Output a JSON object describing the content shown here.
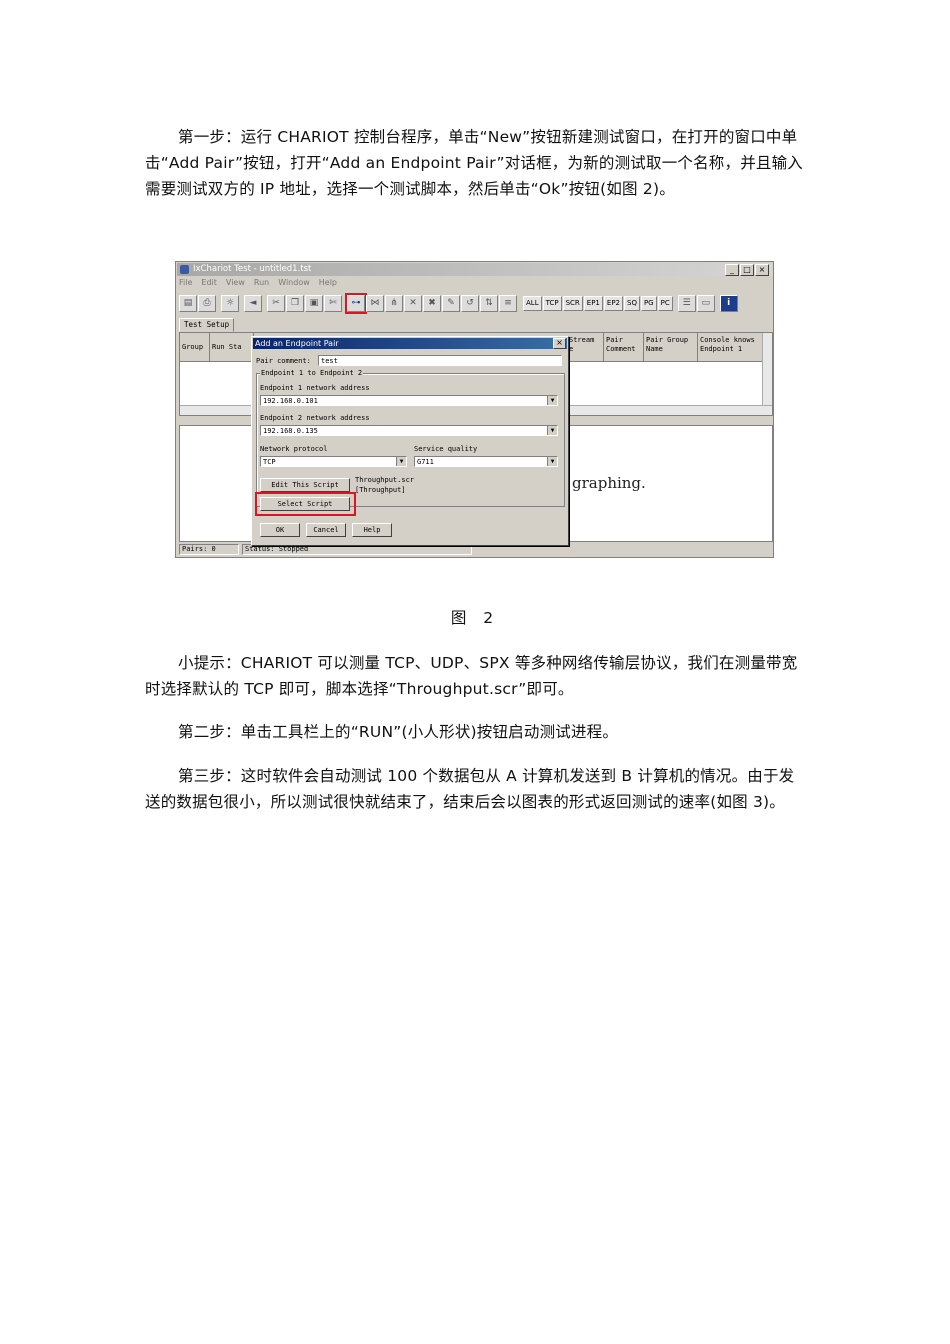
{
  "paragraphs": {
    "p1": "第一步：运行 CHARIOT 控制台程序，单击“New”按钮新建测试窗口，在打开的窗口中单击“Add Pair”按钮，打开“Add an Endpoint Pair”对话框，为新的测试取一个名称，并且输入需要测试双方的 IP 地址，选择一个测试脚本，然后单击“Ok”按钮(如图 2)。",
    "caption": "图 2",
    "p2": "小提示：CHARIOT 可以测量 TCP、UDP、SPX 等多种网络传输层协议，我们在测量带宽时选择默认的 TCP 即可，脚本选择“Throughput.scr”即可。",
    "p3": "第二步：单击工具栏上的“RUN”(小人形状)按钮启动测试进程。",
    "p4": "第三步：这时软件会自动测试 100 个数据包从 A 计算机发送到 B 计算机的情况。由于发送的数据包很小，所以测试很快就结束了，结束后会以图表的形式返回测试的速率(如图 3)。"
  },
  "screenshot": {
    "window_title": "IxChariot Test - untitled1.tst",
    "window_buttons": [
      "_",
      "□",
      "×"
    ],
    "menu": [
      "File",
      "Edit",
      "View",
      "Run",
      "Window",
      "Help"
    ],
    "toolbar_text_buttons": [
      "ALL",
      "TCP",
      "SCR",
      "EP1",
      "EP2",
      "SQ",
      "PG",
      "PC"
    ],
    "tab": "Test Setup",
    "grid_headers_left": [
      "Group",
      "Run Sta"
    ],
    "grid_headers_right": [
      "Stream\ne",
      "Pair\nComment",
      "Pair Group\nName",
      "Console knows\nEndpoint 1"
    ],
    "graphing_text": "graphing.",
    "status": {
      "pairs": "Pairs: 0",
      "status": "Status: Stopped"
    },
    "dialog": {
      "title": "Add an Endpoint Pair",
      "close": "×",
      "pair_comment_label": "Pair comment:",
      "pair_comment_value": "test",
      "group_label": "Endpoint 1 to Endpoint 2",
      "ep1_label": "Endpoint 1 network address",
      "ep1_value": "192.168.0.101",
      "ep2_label": "Endpoint 2 network address",
      "ep2_value": "192.168.0.135",
      "protocol_label": "Network protocol",
      "protocol_value": "TCP",
      "qos_label": "Service quality",
      "qos_value": "G711",
      "edit_script": "Edit This Script",
      "select_script": "Select Script",
      "script_file": "Throughput.scr",
      "script_name": "[Throughput]",
      "ok": "OK",
      "cancel": "Cancel",
      "help": "Help"
    },
    "highlight_color": "#e0141e"
  }
}
